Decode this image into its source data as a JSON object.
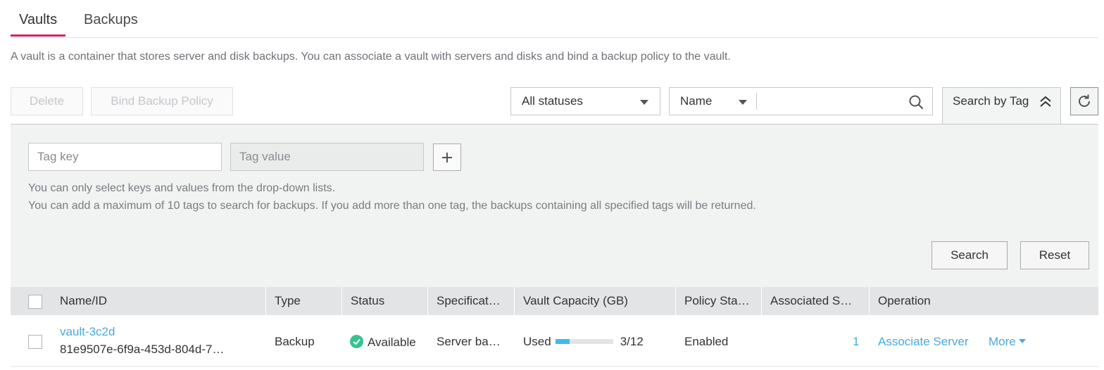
{
  "tabs": [
    {
      "label": "Vaults",
      "active": true
    },
    {
      "label": "Backups",
      "active": false
    }
  ],
  "description": "A vault is a container that stores server and disk backups. You can associate a vault with servers and disks and bind a backup policy to the vault.",
  "toolbar": {
    "delete_label": "Delete",
    "bind_policy_label": "Bind Backup Policy",
    "status_filter": "All statuses",
    "search_field": "Name",
    "search_value": "",
    "search_by_tag_label": "Search by Tag"
  },
  "tag_panel": {
    "tag_key_placeholder": "Tag key",
    "tag_value_placeholder": "Tag value",
    "hint_1": "You can only select keys and values from the drop-down lists.",
    "hint_2": "You can add a maximum of 10 tags to search for backups. If you add more than one tag, the backups containing all specified tags will be returned.",
    "search_label": "Search",
    "reset_label": "Reset"
  },
  "table": {
    "columns": [
      "Name/ID",
      "Type",
      "Status",
      "Specificat…",
      "Vault Capacity (GB)",
      "Policy Sta…",
      "Associated S…",
      "Operation"
    ],
    "rows": [
      {
        "name": "vault-3c2d",
        "id": "81e9507e-6f9a-453d-804d-7…",
        "type": "Backup",
        "status": "Available",
        "specification": "Server ba…",
        "capacity_label": "Used",
        "capacity_value": "3/12",
        "capacity_used_fraction": 0.25,
        "policy_status": "Enabled",
        "associated": "1",
        "operation_primary": "Associate Server",
        "operation_more": "More"
      }
    ]
  },
  "colors": {
    "accent_tab": "#d5206b",
    "link": "#4aa9e1",
    "status_available": "#34c38f",
    "progress": "#3dbbed"
  }
}
